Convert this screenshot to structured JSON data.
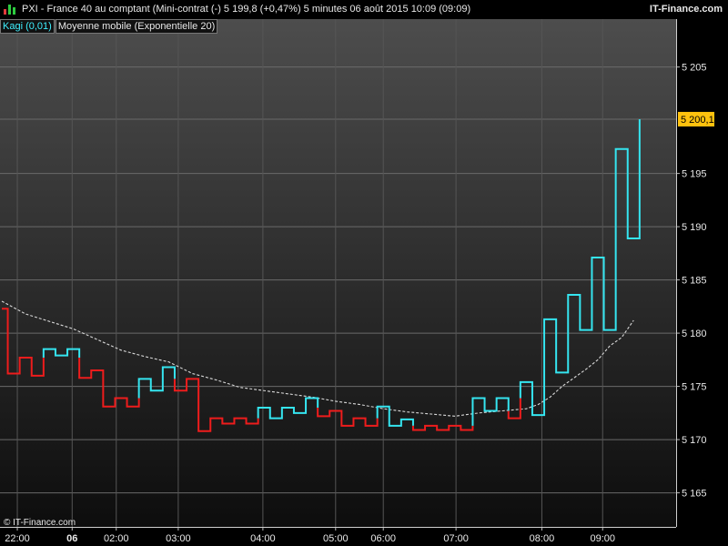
{
  "header": {
    "title": "PXI - France 40 au comptant (Mini-contrat  (-)    5 199,8 (+0,47%)      5 minutes  06 août 2015 10:09 (09:09)",
    "brand": "IT-Finance.com",
    "icon_colors": [
      "#e23b3b",
      "#2ecc40",
      "#2ecc40"
    ]
  },
  "legend": {
    "kagi": "Kagi (0,01)",
    "ma": "Moyenne mobile (Exponentielle 20)"
  },
  "copyright": "© IT-Finance.com",
  "chart_data": {
    "type": "line",
    "style": "kagi",
    "ylim": [
      5161.8,
      5209.5
    ],
    "yticks": [
      5165,
      5170,
      5175,
      5180,
      5185,
      5190,
      5195,
      5205
    ],
    "last_price_label": "5 200,1",
    "last_price": 5200.1,
    "grid": true,
    "colors": {
      "up": "#35e5f0",
      "down": "#ee1c1c",
      "ma": "#d9d9d9",
      "last_badge": "#ffc20e"
    },
    "xticks": [
      {
        "label": "22:00",
        "bold": false,
        "index": 1.3
      },
      {
        "label": "06",
        "bold": true,
        "index": 5.9
      },
      {
        "label": "02:00",
        "bold": false,
        "index": 9.6
      },
      {
        "label": "03:00",
        "bold": false,
        "index": 14.8
      },
      {
        "label": "04:00",
        "bold": false,
        "index": 21.9
      },
      {
        "label": "05:00",
        "bold": false,
        "index": 28.0
      },
      {
        "label": "06:00",
        "bold": false,
        "index": 32.0
      },
      {
        "label": "07:00",
        "bold": false,
        "index": 38.1
      },
      {
        "label": "08:00",
        "bold": false,
        "index": 45.3
      },
      {
        "label": "09:00",
        "bold": false,
        "index": 50.4
      }
    ],
    "kagi": [
      {
        "x": 0,
        "y": 5182.3,
        "c": "down"
      },
      {
        "x": 0.5,
        "y": 5182.3,
        "c": "down"
      },
      {
        "x": 0.5,
        "y": 5176.2,
        "c": "down"
      },
      {
        "x": 1.5,
        "y": 5176.2,
        "c": "down"
      },
      {
        "x": 1.5,
        "y": 5177.7,
        "c": "down"
      },
      {
        "x": 2.5,
        "y": 5177.7,
        "c": "down"
      },
      {
        "x": 2.5,
        "y": 5176.0,
        "c": "down"
      },
      {
        "x": 3.5,
        "y": 5176.0,
        "c": "down"
      },
      {
        "x": 3.5,
        "y": 5177.7,
        "c": "down"
      },
      {
        "x": 3.5,
        "y": 5178.5,
        "c": "up"
      },
      {
        "x": 4.5,
        "y": 5178.5,
        "c": "up"
      },
      {
        "x": 4.5,
        "y": 5177.9,
        "c": "up"
      },
      {
        "x": 5.5,
        "y": 5177.9,
        "c": "up"
      },
      {
        "x": 5.5,
        "y": 5178.5,
        "c": "up"
      },
      {
        "x": 6.5,
        "y": 5178.5,
        "c": "up"
      },
      {
        "x": 6.5,
        "y": 5177.7,
        "c": "up"
      },
      {
        "x": 6.5,
        "y": 5175.8,
        "c": "down"
      },
      {
        "x": 7.5,
        "y": 5175.8,
        "c": "down"
      },
      {
        "x": 7.5,
        "y": 5176.5,
        "c": "down"
      },
      {
        "x": 8.5,
        "y": 5176.5,
        "c": "down"
      },
      {
        "x": 8.5,
        "y": 5173.1,
        "c": "down"
      },
      {
        "x": 9.5,
        "y": 5173.1,
        "c": "down"
      },
      {
        "x": 9.5,
        "y": 5173.9,
        "c": "down"
      },
      {
        "x": 10.5,
        "y": 5173.9,
        "c": "down"
      },
      {
        "x": 10.5,
        "y": 5173.1,
        "c": "down"
      },
      {
        "x": 11.5,
        "y": 5173.1,
        "c": "down"
      },
      {
        "x": 11.5,
        "y": 5173.9,
        "c": "down"
      },
      {
        "x": 11.5,
        "y": 5175.7,
        "c": "up"
      },
      {
        "x": 12.5,
        "y": 5175.7,
        "c": "up"
      },
      {
        "x": 12.5,
        "y": 5174.6,
        "c": "up"
      },
      {
        "x": 13.5,
        "y": 5174.6,
        "c": "up"
      },
      {
        "x": 13.5,
        "y": 5176.8,
        "c": "up"
      },
      {
        "x": 14.5,
        "y": 5176.8,
        "c": "up"
      },
      {
        "x": 14.5,
        "y": 5175.7,
        "c": "up"
      },
      {
        "x": 14.5,
        "y": 5174.6,
        "c": "down"
      },
      {
        "x": 15.5,
        "y": 5174.6,
        "c": "down"
      },
      {
        "x": 15.5,
        "y": 5175.7,
        "c": "down"
      },
      {
        "x": 16.5,
        "y": 5175.7,
        "c": "down"
      },
      {
        "x": 16.5,
        "y": 5170.8,
        "c": "down"
      },
      {
        "x": 17.5,
        "y": 5170.8,
        "c": "down"
      },
      {
        "x": 17.5,
        "y": 5172.0,
        "c": "down"
      },
      {
        "x": 18.5,
        "y": 5172.0,
        "c": "down"
      },
      {
        "x": 18.5,
        "y": 5171.5,
        "c": "down"
      },
      {
        "x": 19.5,
        "y": 5171.5,
        "c": "down"
      },
      {
        "x": 19.5,
        "y": 5172.0,
        "c": "down"
      },
      {
        "x": 20.5,
        "y": 5172.0,
        "c": "down"
      },
      {
        "x": 20.5,
        "y": 5171.5,
        "c": "down"
      },
      {
        "x": 21.5,
        "y": 5171.5,
        "c": "down"
      },
      {
        "x": 21.5,
        "y": 5172.0,
        "c": "down"
      },
      {
        "x": 21.5,
        "y": 5173.0,
        "c": "up"
      },
      {
        "x": 22.5,
        "y": 5173.0,
        "c": "up"
      },
      {
        "x": 22.5,
        "y": 5172.0,
        "c": "up"
      },
      {
        "x": 23.5,
        "y": 5172.0,
        "c": "up"
      },
      {
        "x": 23.5,
        "y": 5173.0,
        "c": "up"
      },
      {
        "x": 24.5,
        "y": 5173.0,
        "c": "up"
      },
      {
        "x": 24.5,
        "y": 5172.5,
        "c": "up"
      },
      {
        "x": 25.5,
        "y": 5172.5,
        "c": "up"
      },
      {
        "x": 25.5,
        "y": 5173.9,
        "c": "up"
      },
      {
        "x": 26.5,
        "y": 5173.9,
        "c": "up"
      },
      {
        "x": 26.5,
        "y": 5173.0,
        "c": "up"
      },
      {
        "x": 26.5,
        "y": 5172.2,
        "c": "down"
      },
      {
        "x": 27.5,
        "y": 5172.2,
        "c": "down"
      },
      {
        "x": 27.5,
        "y": 5172.7,
        "c": "down"
      },
      {
        "x": 28.5,
        "y": 5172.7,
        "c": "down"
      },
      {
        "x": 28.5,
        "y": 5171.3,
        "c": "down"
      },
      {
        "x": 29.5,
        "y": 5171.3,
        "c": "down"
      },
      {
        "x": 29.5,
        "y": 5172.0,
        "c": "down"
      },
      {
        "x": 30.5,
        "y": 5172.0,
        "c": "down"
      },
      {
        "x": 30.5,
        "y": 5171.3,
        "c": "down"
      },
      {
        "x": 31.5,
        "y": 5171.3,
        "c": "down"
      },
      {
        "x": 31.5,
        "y": 5172.0,
        "c": "down"
      },
      {
        "x": 31.5,
        "y": 5173.1,
        "c": "up"
      },
      {
        "x": 32.5,
        "y": 5173.1,
        "c": "up"
      },
      {
        "x": 32.5,
        "y": 5171.3,
        "c": "up"
      },
      {
        "x": 33.5,
        "y": 5171.3,
        "c": "up"
      },
      {
        "x": 33.5,
        "y": 5171.9,
        "c": "up"
      },
      {
        "x": 34.5,
        "y": 5171.9,
        "c": "up"
      },
      {
        "x": 34.5,
        "y": 5171.3,
        "c": "up"
      },
      {
        "x": 34.5,
        "y": 5170.9,
        "c": "down"
      },
      {
        "x": 35.5,
        "y": 5170.9,
        "c": "down"
      },
      {
        "x": 35.5,
        "y": 5171.3,
        "c": "down"
      },
      {
        "x": 36.5,
        "y": 5171.3,
        "c": "down"
      },
      {
        "x": 36.5,
        "y": 5170.9,
        "c": "down"
      },
      {
        "x": 37.5,
        "y": 5170.9,
        "c": "down"
      },
      {
        "x": 37.5,
        "y": 5171.3,
        "c": "down"
      },
      {
        "x": 38.5,
        "y": 5171.3,
        "c": "down"
      },
      {
        "x": 38.5,
        "y": 5170.9,
        "c": "down"
      },
      {
        "x": 39.5,
        "y": 5170.9,
        "c": "down"
      },
      {
        "x": 39.5,
        "y": 5171.3,
        "c": "down"
      },
      {
        "x": 39.5,
        "y": 5173.9,
        "c": "up"
      },
      {
        "x": 40.5,
        "y": 5173.9,
        "c": "up"
      },
      {
        "x": 40.5,
        "y": 5172.7,
        "c": "up"
      },
      {
        "x": 41.5,
        "y": 5172.7,
        "c": "up"
      },
      {
        "x": 41.5,
        "y": 5173.9,
        "c": "up"
      },
      {
        "x": 42.5,
        "y": 5173.9,
        "c": "up"
      },
      {
        "x": 42.5,
        "y": 5172.7,
        "c": "up"
      },
      {
        "x": 42.5,
        "y": 5172.0,
        "c": "down"
      },
      {
        "x": 43.5,
        "y": 5172.0,
        "c": "down"
      },
      {
        "x": 43.5,
        "y": 5173.9,
        "c": "down"
      },
      {
        "x": 43.5,
        "y": 5175.4,
        "c": "up"
      },
      {
        "x": 44.5,
        "y": 5175.4,
        "c": "up"
      },
      {
        "x": 44.5,
        "y": 5172.3,
        "c": "up"
      },
      {
        "x": 45.5,
        "y": 5172.3,
        "c": "up"
      },
      {
        "x": 45.5,
        "y": 5181.3,
        "c": "up"
      },
      {
        "x": 46.5,
        "y": 5181.3,
        "c": "up"
      },
      {
        "x": 46.5,
        "y": 5176.3,
        "c": "up"
      },
      {
        "x": 47.5,
        "y": 5176.3,
        "c": "up"
      },
      {
        "x": 47.5,
        "y": 5183.6,
        "c": "up"
      },
      {
        "x": 48.5,
        "y": 5183.6,
        "c": "up"
      },
      {
        "x": 48.5,
        "y": 5180.3,
        "c": "up"
      },
      {
        "x": 49.5,
        "y": 5180.3,
        "c": "up"
      },
      {
        "x": 49.5,
        "y": 5187.1,
        "c": "up"
      },
      {
        "x": 50.5,
        "y": 5187.1,
        "c": "up"
      },
      {
        "x": 50.5,
        "y": 5180.3,
        "c": "up"
      },
      {
        "x": 51.5,
        "y": 5180.3,
        "c": "up"
      },
      {
        "x": 51.5,
        "y": 5197.3,
        "c": "up"
      },
      {
        "x": 52.5,
        "y": 5197.3,
        "c": "up"
      },
      {
        "x": 52.5,
        "y": 5188.9,
        "c": "up"
      },
      {
        "x": 53.5,
        "y": 5188.9,
        "c": "up"
      },
      {
        "x": 53.5,
        "y": 5200.1,
        "c": "up"
      }
    ],
    "moving_average": [
      [
        0,
        5183.0
      ],
      [
        2,
        5181.8
      ],
      [
        4,
        5181.1
      ],
      [
        6,
        5180.4
      ],
      [
        8,
        5179.4
      ],
      [
        10,
        5178.4
      ],
      [
        12,
        5177.8
      ],
      [
        14,
        5177.3
      ],
      [
        16,
        5176.2
      ],
      [
        18,
        5175.6
      ],
      [
        20,
        5174.9
      ],
      [
        22,
        5174.6
      ],
      [
        24,
        5174.3
      ],
      [
        26,
        5174.0
      ],
      [
        28,
        5173.6
      ],
      [
        30,
        5173.3
      ],
      [
        32,
        5172.9
      ],
      [
        34,
        5172.6
      ],
      [
        36,
        5172.4
      ],
      [
        38,
        5172.2
      ],
      [
        40,
        5172.5
      ],
      [
        42,
        5172.7
      ],
      [
        43,
        5172.8
      ],
      [
        44,
        5172.9
      ],
      [
        45,
        5173.3
      ],
      [
        46,
        5174.0
      ],
      [
        47,
        5175.0
      ],
      [
        48,
        5175.8
      ],
      [
        49,
        5176.6
      ],
      [
        50,
        5177.5
      ],
      [
        51,
        5178.8
      ],
      [
        52,
        5179.6
      ],
      [
        53,
        5181.2
      ]
    ]
  }
}
